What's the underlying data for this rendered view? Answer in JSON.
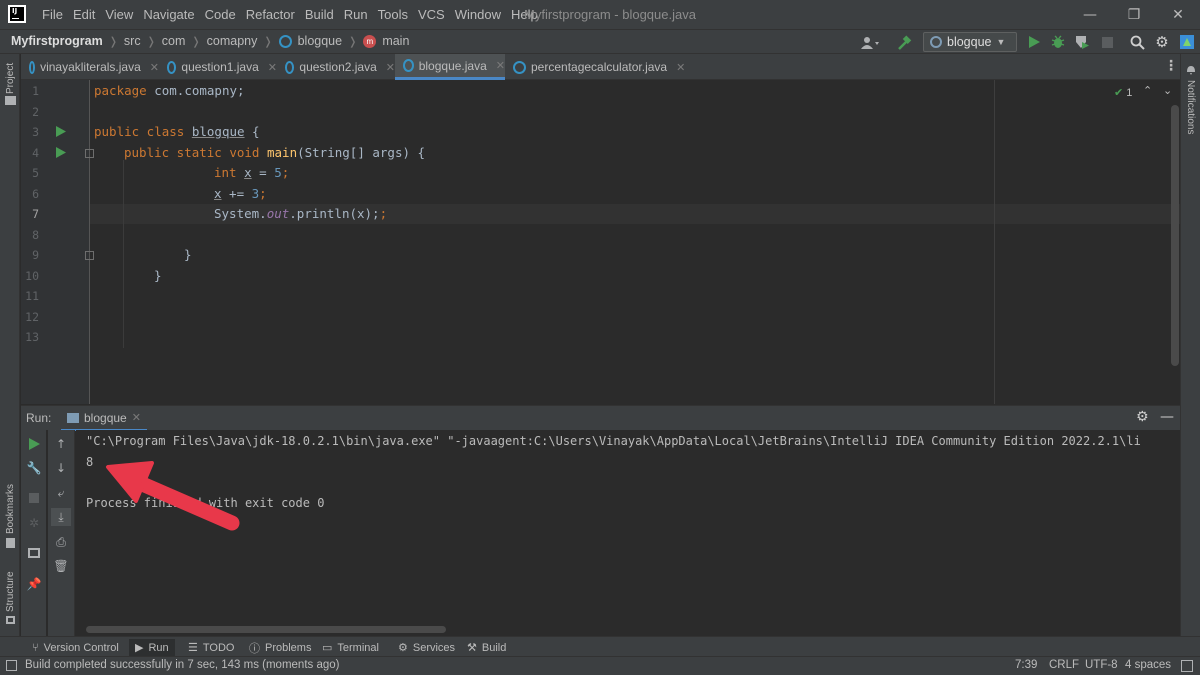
{
  "window": {
    "title": "Myfirstprogram - blogque.java",
    "minimize": "—",
    "restore": "❐",
    "close": "✕"
  },
  "menu": [
    "File",
    "Edit",
    "View",
    "Navigate",
    "Code",
    "Refactor",
    "Build",
    "Run",
    "Tools",
    "VCS",
    "Window",
    "Help"
  ],
  "breadcrumb": {
    "project": "Myfirstprogram",
    "items": [
      "src",
      "com",
      "comapny",
      "blogque",
      "main"
    ]
  },
  "toolbar": {
    "run_config": "blogque"
  },
  "tabs": [
    {
      "label": "vinayakliterals.java",
      "active": false
    },
    {
      "label": "question1.java",
      "active": false
    },
    {
      "label": "question2.java",
      "active": false
    },
    {
      "label": "blogque.java",
      "active": true
    },
    {
      "label": "percentagecalculator.java",
      "active": false
    }
  ],
  "editor": {
    "line_numbers": [
      "1",
      "2",
      "3",
      "4",
      "5",
      "6",
      "7",
      "8",
      "9",
      "10",
      "11",
      "12",
      "13"
    ],
    "inspection_count": "1",
    "code": {
      "line1_kw": "package",
      "line1_rest": " com.comapny;",
      "line3_kw": "public class",
      "line3_name": "blogque",
      "line3_rest": " {",
      "line4_kw": "public static void",
      "line4_name": "main",
      "line4_rest": "(String[] args) {",
      "line5_kw": "int",
      "line5_var": "x",
      "line5_eq": " = ",
      "line5_num": "5",
      "line5_end": ";",
      "line6_var": "x",
      "line6_op": " += ",
      "line6_num": "3",
      "line6_end": ";",
      "line7_a": "System.",
      "line7_fld": "out",
      "line7_b": ".println(x);",
      "line9": "}",
      "line10": "}"
    }
  },
  "run": {
    "label": "Run:",
    "tab": "blogque",
    "console": [
      "\"C:\\Program Files\\Java\\jdk-18.0.2.1\\bin\\java.exe\" \"-javaagent:C:\\Users\\Vinayak\\AppData\\Local\\JetBrains\\IntelliJ IDEA Community Edition 2022.2.1\\li",
      "8",
      "",
      "Process finished with exit code 0"
    ]
  },
  "side": {
    "left_top": "Project",
    "left_bookmarks": "Bookmarks",
    "left_structure": "Structure",
    "right": "Notifications"
  },
  "toolwindows": [
    "Version Control",
    "Run",
    "TODO",
    "Problems",
    "Terminal",
    "Services",
    "Build"
  ],
  "status": {
    "message": "Build completed successfully in 7 sec, 143 ms (moments ago)",
    "position": "7:39",
    "line_sep": "CRLF",
    "encoding": "UTF-8",
    "indent": "4 spaces"
  },
  "colors": {
    "accent": "#4a88c7",
    "run_green": "#499c54",
    "annotation_arrow": "#e8384a"
  }
}
